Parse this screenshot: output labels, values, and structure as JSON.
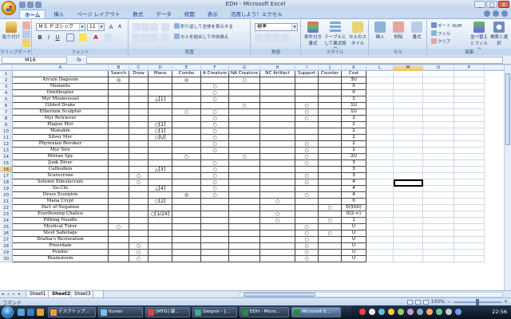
{
  "window": {
    "title": "EDH - Microsoft Excel"
  },
  "tabs": [
    "ホーム",
    "挿入",
    "ページ レイアウト",
    "数式",
    "データ",
    "校閲",
    "表示",
    "活用しよう！エクセル"
  ],
  "ribbon": {
    "paste": "貼り付け",
    "clipboard": "クリップボード",
    "font_name": "ＭＳ Ｐゴシック",
    "font_size": "11",
    "font_group": "フォント",
    "wrap_text": "折り返して全体を表示する",
    "merge_center": "セルを結合して中央揃え",
    "alignment_group": "配置",
    "number_format": "標準",
    "number_group": "数値",
    "conditional_format": "条件付き書式",
    "format_as_table": "テーブルとして書式設定",
    "cell_styles": "セルのスタイル",
    "styles_group": "スタイル",
    "insert": "挿入",
    "delete": "削除",
    "format": "書式",
    "cells_group": "セル",
    "autosum": "オート SUM",
    "fill": "フィル",
    "clear": "クリア",
    "sort_filter": "並べ替えとフィルタ",
    "find_select": "検索と選択",
    "editing_group": "編集"
  },
  "formula_bar": {
    "name_box": "M16",
    "fx": "fx",
    "value": ""
  },
  "columns": [
    "A",
    "B",
    "C",
    "D",
    "E",
    "F",
    "G",
    "H",
    "I",
    "J",
    "K",
    "L",
    "M",
    "O",
    "P"
  ],
  "header_row": [
    "",
    "Search",
    "Draw",
    "Mana",
    "Combo",
    "A Creature",
    "NA Creature",
    "NC Artifact",
    "Support",
    "Counter",
    "Cost"
  ],
  "rows": [
    {
      "n": "2",
      "c": [
        "Arcum Dagsson",
        "◎",
        "",
        "",
        "◎",
        "",
        "○",
        "",
        "",
        "",
        "3U"
      ]
    },
    {
      "n": "3",
      "c": [
        "Memnite",
        "",
        "",
        "",
        "",
        "○",
        "",
        "",
        "",
        "",
        "0"
      ]
    },
    {
      "n": "4",
      "c": [
        "Ornithopter",
        "",
        "",
        "",
        "",
        "○",
        "",
        "",
        "",
        "",
        "0"
      ]
    },
    {
      "n": "5",
      "c": [
        "Myr Moonvessel",
        "",
        "",
        "△[1]",
        "",
        "○",
        "",
        "",
        "",
        "",
        "1"
      ]
    },
    {
      "n": "6",
      "c": [
        "Gilded Drake",
        "",
        "",
        "",
        "",
        "",
        "○",
        "",
        "○",
        "",
        "1U"
      ]
    },
    {
      "n": "7",
      "c": [
        "Etherium Sculptor",
        "",
        "",
        "",
        "○",
        "○",
        "",
        "",
        "○",
        "",
        "1U"
      ]
    },
    {
      "n": "8",
      "c": [
        "Myr Retriever",
        "",
        "",
        "",
        "",
        "○",
        "",
        "",
        "○",
        "",
        "2"
      ]
    },
    {
      "n": "9",
      "c": [
        "Plague Myr",
        "",
        "",
        "○[1]",
        "",
        "○",
        "",
        "",
        "",
        "",
        "2"
      ]
    },
    {
      "n": "10",
      "c": [
        "Manakin",
        "",
        "",
        "○[1]",
        "",
        "○",
        "",
        "",
        "",
        "",
        "2"
      ]
    },
    {
      "n": "11",
      "c": [
        "Silver Myr",
        "",
        "",
        "○[U]",
        "",
        "○",
        "",
        "",
        "",
        "",
        "2"
      ]
    },
    {
      "n": "12",
      "c": [
        "Phyrexian Revoker",
        "",
        "",
        "",
        "",
        "○",
        "",
        "",
        "○",
        "",
        "2"
      ]
    },
    {
      "n": "13",
      "c": [
        "Myr Sire",
        "",
        "",
        "",
        "",
        "○",
        "",
        "",
        "○",
        "",
        "2"
      ]
    },
    {
      "n": "14",
      "c": [
        "Mirran Spy",
        "",
        "",
        "",
        "○",
        "",
        "○",
        "",
        "○",
        "",
        "2U"
      ]
    },
    {
      "n": "15",
      "c": [
        "Junk Diver",
        "",
        "",
        "",
        "",
        "○",
        "",
        "",
        "○",
        "",
        "3"
      ]
    },
    {
      "n": "16",
      "c": [
        "Cathodion",
        "",
        "",
        "△[3]",
        "",
        "○",
        "",
        "",
        "",
        "",
        "3"
      ]
    },
    {
      "n": "17",
      "c": [
        "Scarecrone",
        "",
        "○",
        "",
        "",
        "○",
        "",
        "",
        "○",
        "",
        "3"
      ]
    },
    {
      "n": "18",
      "c": [
        "Solemn Simulacrum",
        "",
        "○",
        "",
        "",
        "○",
        "",
        "",
        "○",
        "",
        "4"
      ]
    },
    {
      "n": "19",
      "c": [
        "Su-Chi",
        "",
        "",
        "△[4]",
        "",
        "○",
        "",
        "",
        "",
        "",
        "4"
      ]
    },
    {
      "n": "20",
      "c": [
        "Dross Scorpion",
        "",
        "",
        "",
        "◎",
        "○",
        "",
        "",
        "○",
        "",
        "4"
      ]
    },
    {
      "n": "21",
      "c": [
        "Mana Crypt",
        "",
        "",
        "○[2]",
        "",
        "",
        "",
        "○",
        "",
        "",
        "0"
      ]
    },
    {
      "n": "22",
      "c": [
        "Pact of Negation",
        "",
        "",
        "",
        "",
        "",
        "",
        "",
        "",
        "○",
        "0(3UU)"
      ]
    },
    {
      "n": "23",
      "c": [
        "Everflowing Chalice",
        "",
        "",
        "○[1/2X]",
        "",
        "",
        "",
        "○",
        "",
        "",
        "0(2-∞)"
      ]
    },
    {
      "n": "24",
      "c": [
        "Pithing Needle",
        "",
        "",
        "",
        "",
        "",
        "",
        "○",
        "",
        "○",
        "1"
      ]
    },
    {
      "n": "25",
      "c": [
        "Mystical Tutor",
        "○",
        "",
        "",
        "",
        "",
        "",
        "",
        "○",
        "",
        "U"
      ]
    },
    {
      "n": "26",
      "c": [
        "Steel Sabotage",
        "",
        "",
        "",
        "",
        "",
        "",
        "",
        "○",
        "○",
        "U"
      ]
    },
    {
      "n": "27",
      "c": [
        "Drafna's Restoration",
        "",
        "",
        "",
        "",
        "",
        "",
        "",
        "○",
        "",
        "U"
      ]
    },
    {
      "n": "28",
      "c": [
        "Preordain",
        "",
        "○",
        "",
        "",
        "",
        "",
        "",
        "○",
        "",
        "U"
      ]
    },
    {
      "n": "29",
      "c": [
        "Ponder",
        "",
        "○",
        "",
        "",
        "",
        "",
        "",
        "○",
        "",
        "U"
      ]
    },
    {
      "n": "30",
      "c": [
        "Brainstorm",
        "",
        "○",
        "",
        "",
        "",
        "",
        "",
        "○",
        "",
        "U"
      ]
    }
  ],
  "sheet_tabs": [
    "Sheet1",
    "Sheet2",
    "Sheet3"
  ],
  "active_sheet": "Sheet2",
  "status": {
    "mode": "コマンド",
    "zoom": "100%"
  },
  "taskbar": {
    "items": [
      "デスクトップ...",
      "Itunes",
      "[MTG] 最...",
      "Sleipnir - [...",
      "EDH - Micro...",
      "Microsoft E..."
    ],
    "clock": "22:56"
  }
}
